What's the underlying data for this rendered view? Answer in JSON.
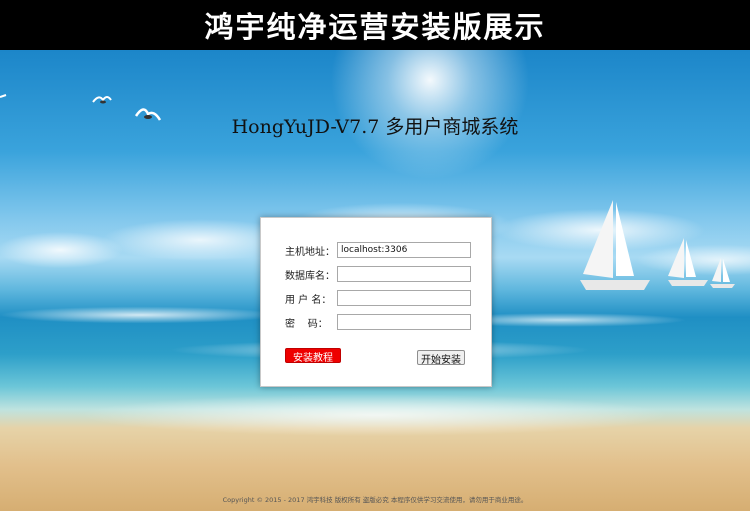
{
  "banner": {
    "title": "鸿宇纯净运营安装版展示"
  },
  "header": {
    "system_title": "HongYuJD-V7.7 多用户商城系统"
  },
  "form": {
    "host_label": "主机地址：",
    "host_value": "localhost:3306",
    "db_label": "数据库名：",
    "db_value": "",
    "user_label": "用 户 名：",
    "user_value": "",
    "password_label": "密    码：",
    "password_value": "",
    "tutorial_button": "安装教程",
    "install_button": "开始安装"
  },
  "footer": {
    "copyright": "Copyright © 2015 - 2017 鸿宇科技 版权所有 盗版必究 本程序仅供学习交流使用，请勿用于商业用途。"
  },
  "colors": {
    "tutorial_button_bg": "#ee0000",
    "banner_bg": "#000000"
  },
  "icons": [
    "seagull-icon",
    "sailboat-icon"
  ]
}
